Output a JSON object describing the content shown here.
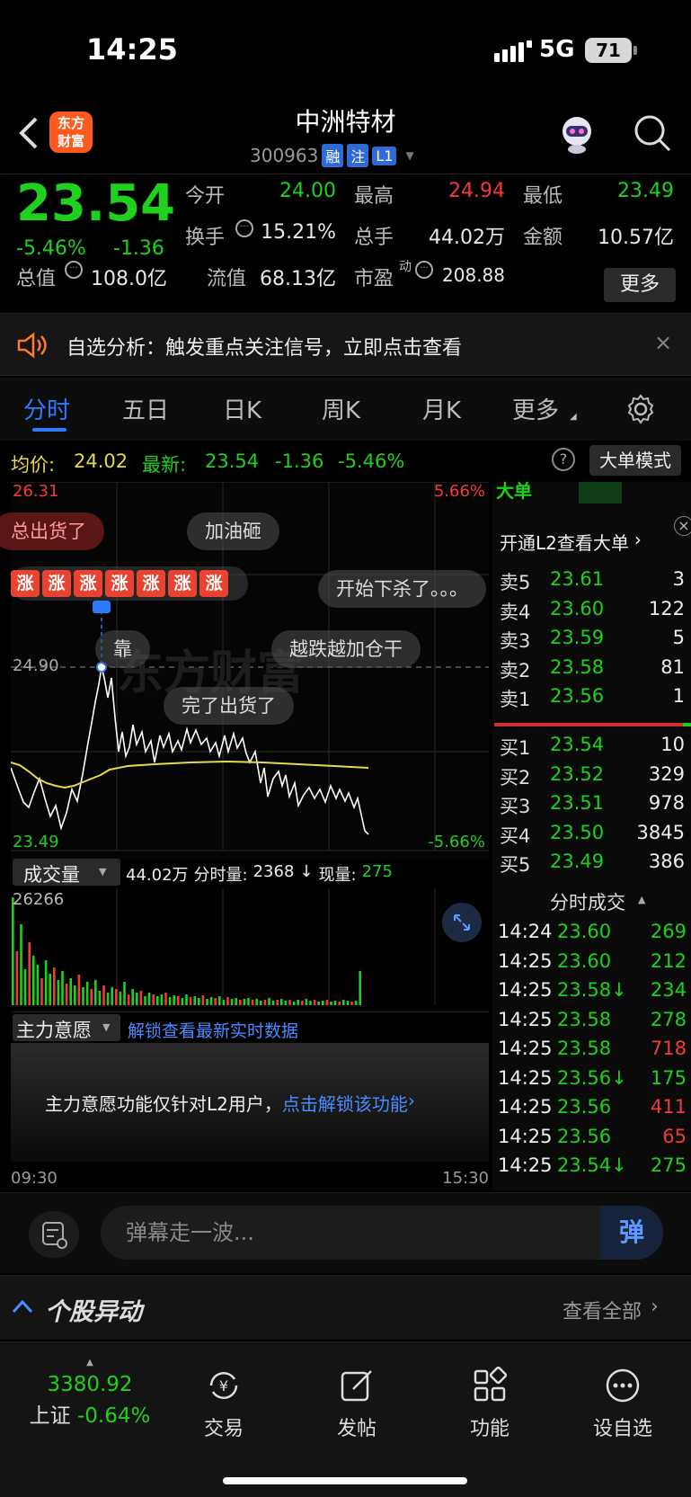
{
  "status_bar": {
    "time": "14:25",
    "network": "5G",
    "battery": "71"
  },
  "header": {
    "logo_line1": "东方",
    "logo_line2": "财富",
    "stock_name": "中洲特材",
    "stock_code": "300963",
    "tags": [
      "融",
      "注",
      "L1"
    ]
  },
  "quote": {
    "price": "23.54",
    "change_pct": "-5.46%",
    "change": "-1.36",
    "open_label": "今开",
    "open": "24.00",
    "high_label": "最高",
    "high": "24.94",
    "low_label": "最低",
    "low": "23.49",
    "turnover_label": "换手",
    "turnover": "15.21%",
    "volume_label": "总手",
    "volume": "44.02万",
    "amount_label": "金额",
    "amount": "10.57亿",
    "mktcap_label": "总值",
    "mktcap": "108.0亿",
    "float_label": "流值",
    "float": "68.13亿",
    "pe_label": "市盈",
    "pe_sup": "动",
    "pe": "208.88",
    "more_label": "更多"
  },
  "notice": {
    "text": "自选分析：触发重点关注信号，立即点击查看",
    "close": "×"
  },
  "tabs": [
    {
      "label": "分时"
    },
    {
      "label": "五日"
    },
    {
      "label": "日K"
    },
    {
      "label": "周K"
    },
    {
      "label": "月K"
    },
    {
      "label": "更多"
    }
  ],
  "chart_info": {
    "avg_label": "均价:",
    "avg": "24.02",
    "latest_label": "最新:",
    "latest": "23.54",
    "latest_chg": "-1.36",
    "latest_pct": "-5.46%",
    "help": "?",
    "big_order_btn": "大单模式"
  },
  "chart_labels": {
    "top_price": "26.31",
    "top_pct": "5.66%",
    "mid_price": "24.90",
    "bottom_price": "23.49",
    "bottom_pct": "-5.66%",
    "watermark": "东方财富"
  },
  "danmaku_bubbles": [
    {
      "text": "总出货了"
    },
    {
      "text": "加油砸"
    },
    {
      "text": "开始下杀了。。。"
    },
    {
      "text": "靠"
    },
    {
      "text": "越跌越加仓干"
    },
    {
      "text": "完了出货了"
    }
  ],
  "rise_badge": "涨",
  "volume": {
    "selector": "成交量",
    "total": "44.02万",
    "minute_label": "分时量:",
    "minute": "2368",
    "current_label": "现量:",
    "current": "275",
    "max": "26266"
  },
  "intent": {
    "selector": "主力意愿",
    "unlock_link": "解锁查看最新实时数据",
    "message": "主力意愿功能仅针对L2用户，",
    "message_link": "点击解锁该功能"
  },
  "time_axis": {
    "start": "09:30",
    "end": "15:30"
  },
  "right_panel": {
    "big_order_title": "大单",
    "l2_link": "开通L2查看大单",
    "asks": [
      {
        "label": "卖5",
        "price": "23.61",
        "vol": "3"
      },
      {
        "label": "卖4",
        "price": "23.60",
        "vol": "122"
      },
      {
        "label": "卖3",
        "price": "23.59",
        "vol": "5"
      },
      {
        "label": "卖2",
        "price": "23.58",
        "vol": "81"
      },
      {
        "label": "卖1",
        "price": "23.56",
        "vol": "1"
      }
    ],
    "bids": [
      {
        "label": "买1",
        "price": "23.54",
        "vol": "10"
      },
      {
        "label": "买2",
        "price": "23.52",
        "vol": "329"
      },
      {
        "label": "买3",
        "price": "23.51",
        "vol": "978"
      },
      {
        "label": "买4",
        "price": "23.50",
        "vol": "3845"
      },
      {
        "label": "买5",
        "price": "23.49",
        "vol": "386"
      }
    ],
    "trades_title": "分时成交",
    "trades": [
      {
        "time": "14:24",
        "price": "23.60",
        "vol": "269",
        "dir": "buy"
      },
      {
        "time": "14:25",
        "price": "23.60",
        "vol": "212",
        "dir": "buy"
      },
      {
        "time": "14:25",
        "price": "23.58↓",
        "vol": "234",
        "dir": "buy"
      },
      {
        "time": "14:25",
        "price": "23.58",
        "vol": "278",
        "dir": "buy"
      },
      {
        "time": "14:25",
        "price": "23.58",
        "vol": "718",
        "dir": "sell"
      },
      {
        "time": "14:25",
        "price": "23.56↓",
        "vol": "175",
        "dir": "buy"
      },
      {
        "time": "14:25",
        "price": "23.56",
        "vol": "411",
        "dir": "sell"
      },
      {
        "time": "14:25",
        "price": "23.56",
        "vol": "65",
        "dir": "sell"
      },
      {
        "time": "14:25",
        "price": "23.54↓",
        "vol": "275",
        "dir": "buy"
      }
    ]
  },
  "danmaku": {
    "placeholder": "弹幕走一波...",
    "send": "弹"
  },
  "movement": {
    "title": "个股异动",
    "see_all": "查看全部"
  },
  "bottom_nav": {
    "index_value": "3380.92",
    "index_name": "上证",
    "index_pct": "-0.64%",
    "items": [
      {
        "label": "交易"
      },
      {
        "label": "发帖"
      },
      {
        "label": "功能"
      },
      {
        "label": "设自选"
      }
    ]
  },
  "colors": {
    "up": "#f23a3a",
    "down": "#1fd01f",
    "accent": "#2f7bff",
    "avg_line": "#e8d84a"
  }
}
